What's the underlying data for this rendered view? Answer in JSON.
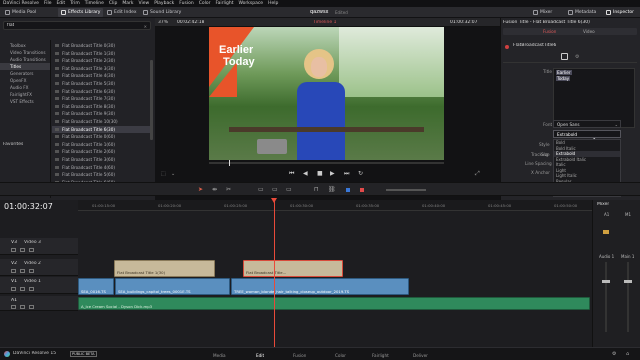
{
  "menu": {
    "items": [
      "DaVinci Resolve",
      "File",
      "Edit",
      "Trim",
      "Timeline",
      "Clip",
      "Mark",
      "View",
      "Playback",
      "Fusion",
      "Color",
      "Fairlight",
      "Workspace",
      "Help"
    ]
  },
  "toolbar": {
    "media_pool": "Media Pool",
    "effects_library": "Effects Library",
    "edit_index": "Edit Index",
    "sound_library": "Sound Library",
    "project_name": "qazwsx",
    "project_status": "Edited",
    "mixer": "Mixer",
    "metadata": "Metadata",
    "inspector": "Inspector"
  },
  "effects": {
    "search_value": "flat",
    "bins": [
      "Toolbox",
      "Video Transitions",
      "Audio Transitions",
      "Titles",
      "Generators",
      "OpenFX",
      "Audio FX",
      "FairlightFX",
      "VST Effects"
    ],
    "selected_bin": "Titles",
    "favorites": "Favorites",
    "titles": [
      "Flat Broadcast Title 0(30)",
      "Flat Broadcast Title 1(30)",
      "Flat Broadcast Title 2(30)",
      "Flat Broadcast Title 3(30)",
      "Flat Broadcast Title 4(30)",
      "Flat Broadcast Title 5(30)",
      "Flat Broadcast Title 6(30)",
      "Flat Broadcast Title 7(30)",
      "Flat Broadcast Title 8(30)",
      "Flat Broadcast Title 9(30)",
      "Flat Broadcast Title 10(30)",
      "Flat Broadcast Title 6(30)",
      "Flat Broadcast Title 0(60)",
      "Flat Broadcast Title 1(60)",
      "Flat Broadcast Title 2(60)",
      "Flat Broadcast Title 3(60)",
      "Flat Broadcast Title 4(60)",
      "Flat Broadcast Title 5(60)",
      "Flat Broadcast Title 6(60)",
      "Flat Broadcast Title 7(60)"
    ],
    "selected_index": 11
  },
  "viewer": {
    "zoom": "37%",
    "source_timecode": "00:02:42:18",
    "timeline_name": "Timeline 1",
    "record_timecode": "01:00:32:07",
    "title_line1": "Earlier",
    "title_line2": "Today"
  },
  "inspector": {
    "header": "Fusion Title - Flat Broadcast Title 6(30)",
    "tab_fusion": "Fusion",
    "tab_video": "Video",
    "node_name": "FlatBroadcastTitle6",
    "label_title": "Title",
    "title_value_1": "Earlier",
    "title_value_2": "Today",
    "label_font": "Font",
    "font_value": "Open Sans",
    "label_style": "Style",
    "style_value": "Extrabold",
    "label_tracking": "Tracking",
    "label_line_spacing": "Line Spacing",
    "label_size": "Size",
    "label_x_anchor": "X Anchor",
    "style_options": [
      "Bold",
      "Bold Italic",
      "Extrabold",
      "Extrabold Italic",
      "Italic",
      "Light",
      "Light Italic",
      "Regular",
      "Semibold",
      "Semibold Italic"
    ],
    "highlighted_option_index": 2
  },
  "timeline": {
    "timecode": "01:00:32:07",
    "ruler_marks": [
      "01:00:15:00",
      "01:00:20:00",
      "01:00:25:00",
      "01:00:30:00",
      "01:00:35:00",
      "01:00:40:00",
      "01:00:45:00",
      "01:00:50:00"
    ],
    "tracks": [
      {
        "id": "V3",
        "name": "Video 3"
      },
      {
        "id": "V2",
        "name": "Video 2"
      },
      {
        "id": "V1",
        "name": "Video 1"
      },
      {
        "id": "A1",
        "name": ""
      }
    ],
    "clips": {
      "title_a": "Flat Broadcast Title 1(30)",
      "title_b": "Flat Broadcast Title...",
      "video_a": "SEA_0016.TS",
      "video_b": "SEA_buildings_capitol_trees_0001E.TS",
      "video_c": "TREE_woman_blonde_hair_talking_closeup_outdoor_2019.TS",
      "audio": "A_Ice Cream Social - Dyson Dick.mp3"
    }
  },
  "mixer": {
    "title": "Mixer",
    "ch1": "A1",
    "ch2": "M1",
    "strip1": "Audio 1",
    "strip2": "Main 1"
  },
  "pages": {
    "app_name": "DaVinci Resolve 15",
    "badge": "PUBLIC BETA",
    "tabs": [
      "Media",
      "Edit",
      "Fusion",
      "Color",
      "Fairlight",
      "Deliver"
    ],
    "active": "Edit"
  }
}
